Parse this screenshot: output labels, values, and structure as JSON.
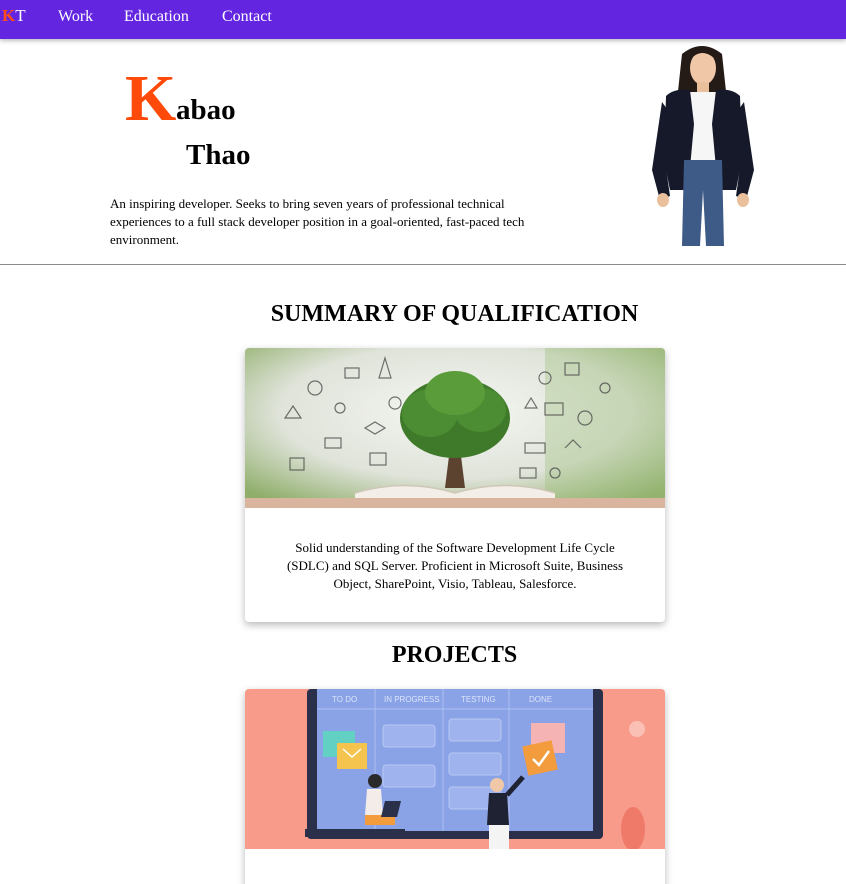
{
  "nav": {
    "logo_k": "K",
    "logo_t": "T",
    "links": [
      "Work",
      "Education",
      "Contact"
    ]
  },
  "hero": {
    "first_initial": "K",
    "first_rest": "abao",
    "last_name": "Thao",
    "tagline": "An inspiring developer. Seeks to bring seven years of professional technical experiences to a full stack developer position in a goal-oriented, fast-paced tech environment."
  },
  "summary": {
    "title": "SUMMARY OF QUALIFICATION",
    "text": "Solid understanding of the Software Development Life Cycle (SDLC) and SQL Server. Proficient in Microsoft Suite, Business Object, SharePoint, Visio, Tableau, Salesforce."
  },
  "projects": {
    "title": "PROJECTS",
    "board_columns": [
      "TO DO",
      "IN PROGRESS",
      "TESTING",
      "DONE"
    ]
  },
  "colors": {
    "navbar": "#6325e0",
    "accent": "#ff4a0a",
    "project_bg": "#f89b8a"
  }
}
